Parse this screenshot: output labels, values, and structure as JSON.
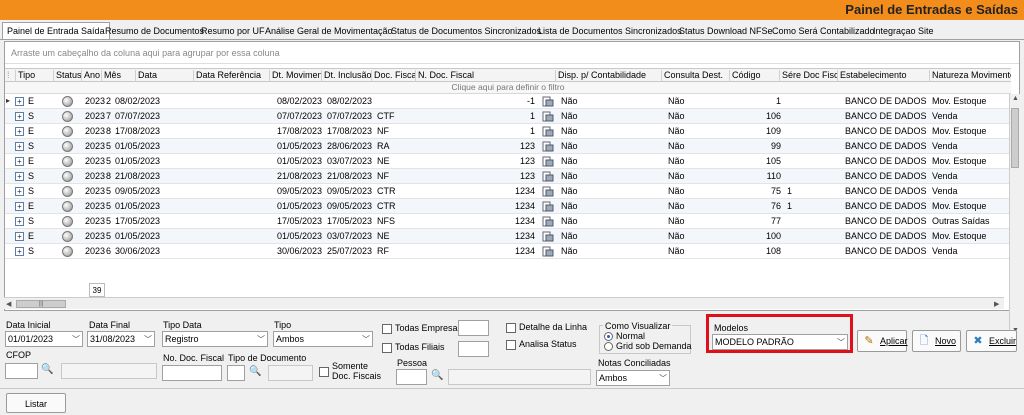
{
  "window": {
    "title": "Painel de Entradas e Saídas",
    "accent_color": "#f28c1a"
  },
  "tabs": [
    {
      "label": "Painel de Entrada Saída",
      "active": true
    },
    {
      "label": "Resumo de Documentos"
    },
    {
      "label": "Resumo por UF"
    },
    {
      "label": "Análise Geral de Movimentação"
    },
    {
      "label": "Status de Documentos Sincronizados"
    },
    {
      "label": "Lista de Documentos Sincronizados"
    },
    {
      "label": "Status Download NFSe"
    },
    {
      "label": "Como Será Contabilizado"
    },
    {
      "label": "Integraçao Site"
    }
  ],
  "grid": {
    "group_hint": "Arraste um cabeçalho da coluna aqui para agrupar por essa coluna",
    "filter_hint": "Clique aqui para definir o filtro",
    "columns": [
      "Tipo",
      "Status",
      "Ano",
      "Mês",
      "Data",
      "Data Referência",
      "Dt. Movimen",
      "Dt. Inclusão",
      "Doc. Fiscal",
      "N. Doc. Fiscal",
      "Disp. p/ Contabilidade",
      "Consulta Dest.",
      "Código",
      "Sére Doc Fiscal",
      "Estabelecimento",
      "Natureza Movimento"
    ],
    "row_count": "39",
    "rows": [
      {
        "tipo": "E",
        "ano": "2023",
        "mes": "2",
        "data": "08/02/2023",
        "dt_mov": "08/02/2023",
        "dt_inc": "08/02/2023",
        "doc": "",
        "ndoc": "-1",
        "disp": "Não",
        "cons": "Não",
        "cod": "1",
        "serie": "",
        "estab": "BANCO DE DADOS PADR",
        "nat": "Mov. Estoque"
      },
      {
        "tipo": "S",
        "ano": "2023",
        "mes": "7",
        "data": "07/07/2023",
        "dt_mov": "07/07/2023",
        "dt_inc": "07/07/2023",
        "doc": "CTF",
        "ndoc": "1",
        "disp": "Não",
        "cons": "Não",
        "cod": "106",
        "serie": "",
        "estab": "BANCO DE DADOS PADR",
        "nat": "Venda"
      },
      {
        "tipo": "E",
        "ano": "2023",
        "mes": "8",
        "data": "17/08/2023",
        "dt_mov": "17/08/2023",
        "dt_inc": "17/08/2023",
        "doc": "NF",
        "ndoc": "1",
        "disp": "Não",
        "cons": "Não",
        "cod": "109",
        "serie": "",
        "estab": "BANCO DE DADOS PADR",
        "nat": "Mov. Estoque"
      },
      {
        "tipo": "S",
        "ano": "2023",
        "mes": "5",
        "data": "01/05/2023",
        "dt_mov": "01/05/2023",
        "dt_inc": "28/06/2023",
        "doc": "RA",
        "ndoc": "123",
        "disp": "Não",
        "cons": "Não",
        "cod": "99",
        "serie": "",
        "estab": "BANCO DE DADOS PADR",
        "nat": "Venda"
      },
      {
        "tipo": "E",
        "ano": "2023",
        "mes": "5",
        "data": "01/05/2023",
        "dt_mov": "01/05/2023",
        "dt_inc": "03/07/2023",
        "doc": "NE",
        "ndoc": "123",
        "disp": "Não",
        "cons": "Não",
        "cod": "105",
        "serie": "",
        "estab": "BANCO DE DADOS PADR",
        "nat": "Mov. Estoque"
      },
      {
        "tipo": "S",
        "ano": "2023",
        "mes": "8",
        "data": "21/08/2023",
        "dt_mov": "21/08/2023",
        "dt_inc": "21/08/2023",
        "doc": "NF",
        "ndoc": "123",
        "disp": "Não",
        "cons": "Não",
        "cod": "110",
        "serie": "",
        "estab": "BANCO DE DADOS PADR",
        "nat": "Venda"
      },
      {
        "tipo": "S",
        "ano": "2023",
        "mes": "5",
        "data": "09/05/2023",
        "dt_mov": "09/05/2023",
        "dt_inc": "09/05/2023",
        "doc": "CTR",
        "ndoc": "1234",
        "disp": "Não",
        "cons": "Não",
        "cod": "75",
        "serie": "1",
        "estab": "BANCO DE DADOS PADR",
        "nat": "Venda"
      },
      {
        "tipo": "E",
        "ano": "2023",
        "mes": "5",
        "data": "01/05/2023",
        "dt_mov": "01/05/2023",
        "dt_inc": "09/05/2023",
        "doc": "CTR",
        "ndoc": "1234",
        "disp": "Não",
        "cons": "Não",
        "cod": "76",
        "serie": "1",
        "estab": "BANCO DE DADOS PADR",
        "nat": "Mov. Estoque"
      },
      {
        "tipo": "S",
        "ano": "2023",
        "mes": "5",
        "data": "17/05/2023",
        "dt_mov": "17/05/2023",
        "dt_inc": "17/05/2023",
        "doc": "NFS",
        "ndoc": "1234",
        "disp": "Não",
        "cons": "Não",
        "cod": "77",
        "serie": "",
        "estab": "BANCO DE DADOS PADR",
        "nat": "Outras Saídas"
      },
      {
        "tipo": "E",
        "ano": "2023",
        "mes": "5",
        "data": "01/05/2023",
        "dt_mov": "01/05/2023",
        "dt_inc": "03/07/2023",
        "doc": "NE",
        "ndoc": "1234",
        "disp": "Não",
        "cons": "Não",
        "cod": "100",
        "serie": "",
        "estab": "BANCO DE DADOS PADR",
        "nat": "Mov. Estoque"
      },
      {
        "tipo": "S",
        "ano": "2023",
        "mes": "6",
        "data": "30/06/2023",
        "dt_mov": "30/06/2023",
        "dt_inc": "25/07/2023",
        "doc": "RF",
        "ndoc": "1234",
        "disp": "Não",
        "cons": "Não",
        "cod": "108",
        "serie": "",
        "estab": "BANCO DE DADOS PADR",
        "nat": "Venda"
      }
    ]
  },
  "filters": {
    "data_inicial_label": "Data Inicial",
    "data_inicial": "01/01/2023",
    "data_final_label": "Data Final",
    "data_final": "31/08/2023",
    "tipo_data_label": "Tipo Data",
    "tipo_data": "Registro",
    "tipo_label": "Tipo",
    "tipo": "Ambos",
    "todas_empresas": "Todas Empresas",
    "todas_filiais": "Todas Filiais",
    "detalhe_linha": "Detalhe da Linha",
    "analisa_status": "Analisa Status",
    "como_visualizar": "Como Visualizar",
    "normal": "Normal",
    "grid_sob_demanda": "Grid sob Demanda",
    "modelos_label": "Modelos",
    "modelo": "MODELO PADRÃO",
    "cfop_label": "CFOP",
    "no_doc_fiscal_label": "No. Doc. Fiscal",
    "tipo_documento_label": "Tipo de Documento",
    "somente_doc_fiscais": "Somente Doc. Fiscais",
    "pessoa_label": "Pessoa",
    "notas_conciliadas_label": "Notas Conciliadas",
    "notas_conciliadas": "Ambos"
  },
  "buttons": {
    "aplicar": "Aplicar",
    "novo": "Novo",
    "excluir": "Excluir",
    "listar": "Listar"
  }
}
